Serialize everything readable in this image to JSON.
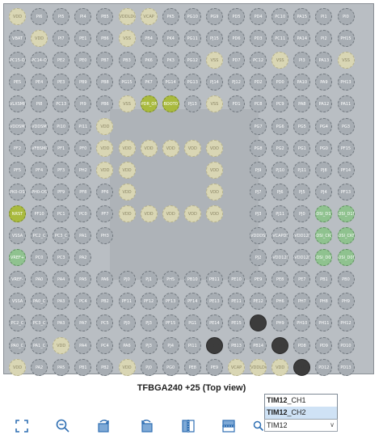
{
  "package": {
    "title": "TFBGA240 +25 (Top view)",
    "rows": [
      [
        "VDD",
        "PI6",
        "PI5",
        "PI4",
        "PB5",
        "VDDLDO",
        "VCAP",
        "PK5",
        "PG10",
        "PG9",
        "PD5",
        "PD4",
        "PC10",
        "PA15",
        "PI1",
        "PI0"
      ],
      [
        "VBAT",
        "VDD",
        "PI7",
        "PE1",
        "PB6",
        "VSS",
        "PB4",
        "PK4",
        "PG11",
        "PJ15",
        "PD6",
        "PD3",
        "PC11",
        "PA14",
        "PI2",
        "PH15"
      ],
      [
        "PC15-OSC32_OUT",
        "PC14-OSC32_IN",
        "PE2",
        "PE0",
        "PB7",
        "PB3",
        "PK6",
        "PK3",
        "PG12",
        "VSS",
        "PD7",
        "PC12",
        "VSS",
        "PI3",
        "PA13",
        "VSS"
      ],
      [
        "PE5",
        "PE4",
        "PE3",
        "PB9",
        "PB8",
        "PG15",
        "PK7",
        "PG14",
        "PG13",
        "PJ14",
        "PJ12",
        "PD2",
        "PD0",
        "PA10",
        "PA9",
        "PH13"
      ],
      [
        "VLXSMPS",
        "PI8",
        "PC13",
        "PI9",
        "PB6",
        "VSS",
        "PDR_ON",
        "BOOT0",
        "PJ13",
        "VSS",
        "PD1",
        "PC8",
        "PC9",
        "PA8",
        "PA12",
        "PA11"
      ],
      [
        "VDDSMPS",
        "VDDSMPS",
        "PI10",
        "PI11",
        "VDD",
        "",
        "",
        "",
        "",
        "",
        "",
        "PG7",
        "PG6",
        "PG5",
        "PG4",
        "PG3"
      ],
      [
        "PF2",
        "VFBSMPS",
        "PF1",
        "PF0",
        "VDD",
        "VDD",
        "VDD",
        "VDD",
        "VDD",
        "VDD",
        "",
        "PG8",
        "PG2",
        "PG1",
        "PG0",
        "PF15"
      ],
      [
        "PF5",
        "PF4",
        "PF3",
        "PH2",
        "VDD",
        "VDD",
        "",
        "",
        "",
        "VDD",
        "",
        "PJ9",
        "PJ10",
        "PJ11",
        "PJ8",
        "PF14"
      ],
      [
        "PK0-OSC_IN",
        "PH0-OSC_IN",
        "PF9",
        "PF8",
        "PF6",
        "VDD",
        "",
        "",
        "",
        "VDD",
        "",
        "PJ7",
        "PJ6",
        "PJ5",
        "PJ4",
        "PF13"
      ],
      [
        "NRST",
        "PF10",
        "PC1",
        "PC0",
        "PF7",
        "VDD",
        "VDD",
        "VDD",
        "VDD",
        "VDD",
        "",
        "PJ3",
        "PJ11",
        "PJ0",
        "DSI_D1P",
        "DSI_D1N"
      ],
      [
        "VSSA",
        "PC2_C",
        "PC3_C",
        "PA1",
        "PH3",
        "",
        "",
        "",
        "",
        "",
        "",
        "VDDDSI",
        "VCAPDSI",
        "VDD12DSI",
        "DSI_CKP",
        "DSI_CKN"
      ],
      [
        "VREF+",
        "PC0",
        "PC3",
        "PA2",
        "",
        "",
        "",
        "",
        "",
        "",
        "",
        "PJ2",
        "VDD12DSI",
        "VDD12DSI",
        "DSI_D0P",
        "DSI_D0N"
      ],
      [
        "VREF-",
        "PA0",
        "PA4",
        "PA5",
        "PA6",
        "PJ0",
        "PJ1",
        "PH5",
        "PB10",
        "PB11",
        "PE10",
        "PE9",
        "PE8",
        "PE7",
        "PB1",
        "PB0"
      ],
      [
        "VSSA",
        "PA0_C",
        "PA3",
        "PC4",
        "PB2",
        "PF11",
        "PF12",
        "PF13",
        "PF14",
        "PE13",
        "PE11",
        "PE12",
        "PH6",
        "PH7",
        "PH8",
        "PH9"
      ],
      [
        "PC2_C",
        "PC3_C",
        "PA3",
        "PA7",
        "PC5",
        "PJ0",
        "PJ3",
        "PF15",
        "PG1",
        "PE14",
        "PE15",
        "",
        "PH9",
        "PH10",
        "PH11",
        "PH12"
      ],
      [
        "PA0_C",
        "PA1_C",
        "VDD",
        "PA4",
        "PC4",
        "PA6",
        "PJ3",
        "PJ4",
        "PI11",
        "PB12",
        "PB13",
        "PB14",
        "PB15",
        "PD8",
        "PD9",
        "PD10"
      ],
      [
        "VDD",
        "PA2",
        "PA5",
        "PB1",
        "PB2",
        "VDD",
        "PJ0",
        "PG0",
        "PE8",
        "PE9",
        "VCAP",
        "VDDLDO",
        "VDD",
        "PD11",
        "PD12",
        "PD13"
      ]
    ],
    "pin_kinds": [
      [
        "pwr",
        "io",
        "io",
        "io",
        "io",
        "pwr",
        "pwr",
        "io",
        "io",
        "io",
        "io",
        "io",
        "io",
        "io",
        "io",
        "io"
      ],
      [
        "io",
        "pwr",
        "io",
        "io",
        "io",
        "pwr",
        "io",
        "io",
        "io",
        "io",
        "io",
        "io",
        "io",
        "io",
        "io",
        "io"
      ],
      [
        "io",
        "io",
        "io",
        "io",
        "io",
        "io",
        "io",
        "io",
        "io",
        "pwr",
        "io",
        "io",
        "pwr",
        "io",
        "io",
        "pwr"
      ],
      [
        "io",
        "io",
        "io",
        "io",
        "io",
        "io",
        "io",
        "io",
        "io",
        "io",
        "io",
        "io",
        "io",
        "io",
        "io",
        "io"
      ],
      [
        "io",
        "io",
        "io",
        "io",
        "io",
        "pwr",
        "olive",
        "olive",
        "io",
        "pwr",
        "io",
        "io",
        "io",
        "io",
        "io",
        "io"
      ],
      [
        "io",
        "io",
        "io",
        "io",
        "pwr",
        "",
        "",
        "",
        "",
        "",
        "",
        "io",
        "io",
        "io",
        "io",
        "io"
      ],
      [
        "io",
        "io",
        "io",
        "io",
        "pwr",
        "pwr",
        "pwr",
        "pwr",
        "pwr",
        "pwr",
        "",
        "io",
        "io",
        "io",
        "io",
        "io"
      ],
      [
        "io",
        "io",
        "io",
        "io",
        "pwr",
        "pwr",
        "",
        "",
        "",
        "pwr",
        "",
        "io",
        "io",
        "io",
        "io",
        "io"
      ],
      [
        "io",
        "io",
        "io",
        "io",
        "io",
        "pwr",
        "",
        "",
        "",
        "pwr",
        "",
        "io",
        "io",
        "io",
        "io",
        "io"
      ],
      [
        "olive",
        "io",
        "io",
        "io",
        "io",
        "pwr",
        "pwr",
        "pwr",
        "pwr",
        "pwr",
        "",
        "io",
        "io",
        "io",
        "green",
        "green"
      ],
      [
        "io",
        "io",
        "io",
        "io",
        "io",
        "",
        "",
        "",
        "",
        "",
        "",
        "io",
        "io",
        "io",
        "green",
        "green"
      ],
      [
        "green",
        "io",
        "io",
        "io",
        "",
        "",
        "",
        "",
        "",
        "",
        "",
        "io",
        "io",
        "io",
        "green",
        "green"
      ],
      [
        "io",
        "io",
        "io",
        "io",
        "io",
        "io",
        "io",
        "io",
        "io",
        "io",
        "io",
        "io",
        "io",
        "io",
        "io",
        "io"
      ],
      [
        "io",
        "io",
        "io",
        "io",
        "io",
        "io",
        "io",
        "io",
        "io",
        "io",
        "io",
        "io",
        "io",
        "io",
        "io",
        "io"
      ],
      [
        "io",
        "io",
        "io",
        "io",
        "io",
        "io",
        "io",
        "io",
        "io",
        "io",
        "io",
        "dark",
        "io",
        "io",
        "io",
        "io"
      ],
      [
        "io",
        "io",
        "pwr",
        "io",
        "io",
        "io",
        "io",
        "io",
        "io",
        "dark",
        "io",
        "io",
        "dark",
        "io",
        "io",
        "io"
      ],
      [
        "pwr",
        "io",
        "io",
        "io",
        "io",
        "pwr",
        "io",
        "io",
        "io",
        "io",
        "pwr",
        "pwr",
        "pwr",
        "dark",
        "io",
        "io"
      ]
    ]
  },
  "toolbar": {
    "icons": [
      "fit-screen-icon",
      "zoom-out-icon",
      "rotate-right-icon",
      "rotate-left-icon",
      "flip-vertical-icon",
      "flip-horizontal-icon"
    ],
    "search_value": "TIM12",
    "options": [
      {
        "bold": "TIM12",
        "rest": "_CH1"
      },
      {
        "bold": "TIM12",
        "rest": "_CH2"
      }
    ]
  },
  "colors": {
    "io": "#a7adb3",
    "power": "#d9d6b4",
    "green": "#8fc28f",
    "olive": "#a9ba3e",
    "highlight": "#3c3c3c"
  }
}
